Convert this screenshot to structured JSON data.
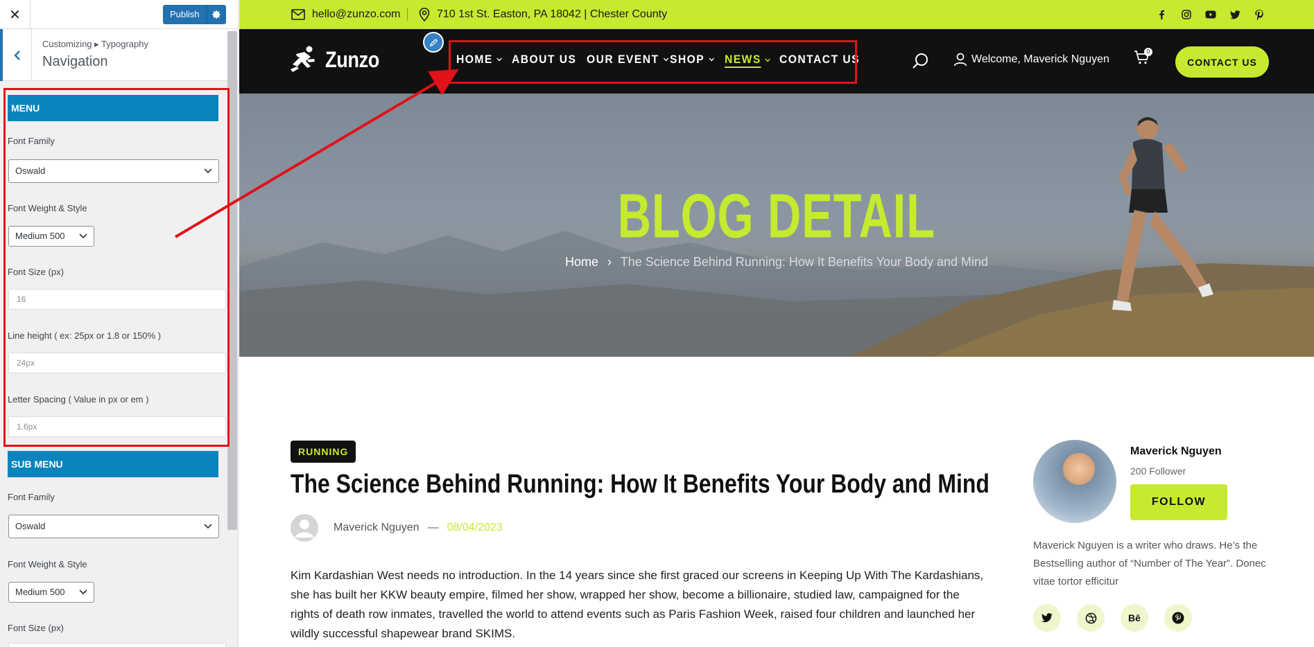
{
  "customizer": {
    "close_icon": "close-icon",
    "publish_label": "Publish",
    "breadcrumb": "Customizing ▸ Typography",
    "section_title": "Navigation",
    "menu": {
      "heading": "MENU",
      "font_family_label": "Font Family",
      "font_family_value": "Oswald",
      "font_weight_label": "Font Weight & Style",
      "font_weight_value": "Medium 500",
      "font_size_label": "Font Size (px)",
      "font_size_value": "16",
      "line_height_label": "Line height ( ex: 25px or 1.8 or 150% )",
      "line_height_value": "24px",
      "letter_spacing_label": "Letter Spacing ( Value in px or em )",
      "letter_spacing_value": "1.6px"
    },
    "submenu": {
      "heading": "SUB MENU",
      "font_family_label": "Font Family",
      "font_family_value": "Oswald",
      "font_weight_label": "Font Weight & Style",
      "font_weight_value": "Medium 500",
      "font_size_label": "Font Size (px)"
    }
  },
  "site": {
    "colors": {
      "accent": "#c6ea2f",
      "dark": "#111111",
      "highlight": "#e2111a"
    },
    "topbar": {
      "email": "hello@zunzo.com",
      "address": "710 1st St. Easton, PA 18042 | Chester County",
      "social_icons": [
        "facebook-icon",
        "instagram-icon",
        "youtube-icon",
        "twitter-icon",
        "pinterest-icon"
      ]
    },
    "logo_text": "Zunzo",
    "menu": [
      "HOME",
      "ABOUT US",
      "OUR EVENT",
      "SHOP",
      "NEWS",
      "CONTACT US"
    ],
    "welcome": "Welcome, Maverick Nguyen",
    "cart_count": "0",
    "contact_button": "CONTACT US",
    "hero": {
      "title": "BLOG DETAIL",
      "crumb_home": "Home",
      "crumb_current": "The Science Behind Running: How It Benefits Your Body and Mind"
    },
    "post": {
      "tag": "RUNNING",
      "title": "The Science Behind Running: How It Benefits Your Body and Mind",
      "author": "Maverick Nguyen",
      "date": "08/04/2023",
      "body": "Kim Kardashian West needs no introduction. In the 14 years since she first graced our screens in Keeping Up With The Kardashians, she has built her KKW beauty empire, filmed her show, wrapped her show, become a billionaire, studied law, campaigned for the rights of death row inmates, travelled the world to attend events such as Paris Fashion Week, raised four children and launched her wildly successful shapewear brand SKIMS."
    },
    "author_box": {
      "name": "Maverick Nguyen",
      "followers": "200 Follower",
      "follow_button": "FOLLOW",
      "bio": "Maverick Nguyen is a writer who draws. He’s the Bestselling author of “Number of The Year”. Donec vitae tortor efficitur",
      "social": [
        "twitter-icon",
        "dribbble-icon",
        "behance-icon",
        "pinterest-icon"
      ],
      "behance_label": "Bē"
    }
  }
}
